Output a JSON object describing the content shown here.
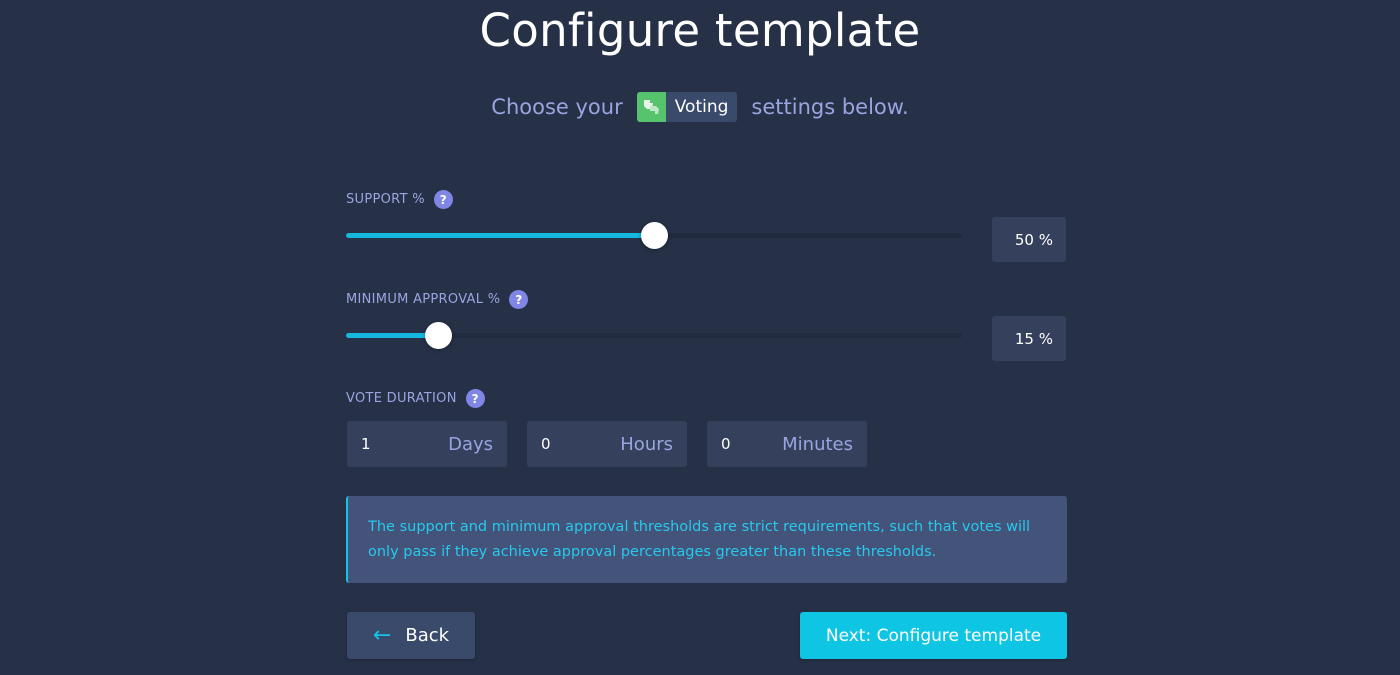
{
  "header": {
    "title": "Configure template",
    "subtitle_before": "Choose your",
    "app_badge": {
      "label": "Voting",
      "icon": "thumbs-up-down-icon",
      "icon_color": "#56c46c"
    },
    "subtitle_after": "settings below."
  },
  "support": {
    "label": "SUPPORT %",
    "help": "?",
    "value": 50,
    "display": "50 %"
  },
  "min_approval": {
    "label": "MINIMUM APPROVAL %",
    "help": "?",
    "value": 15,
    "display": "15 %"
  },
  "duration": {
    "label": "VOTE DURATION",
    "help": "?",
    "fields": [
      {
        "value": "1",
        "unit": "Days"
      },
      {
        "value": "0",
        "unit": "Hours"
      },
      {
        "value": "0",
        "unit": "Minutes"
      }
    ]
  },
  "info": {
    "text": "The support and minimum approval thresholds are strict requirements, such that votes will only pass if they achieve approval percentages greater than these thresholds."
  },
  "buttons": {
    "back_label": "Back",
    "back_icon": "arrow-left-icon",
    "next_label": "Next: Configure template"
  },
  "colors": {
    "background": "#263148",
    "accent": "#14b8dc",
    "label": "#9aa4df",
    "help_icon": "#7f86e6"
  }
}
